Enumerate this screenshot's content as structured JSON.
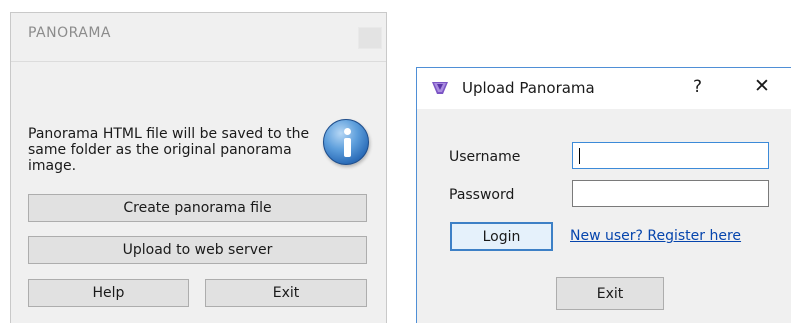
{
  "panorama_window": {
    "title": "PANORAMA",
    "message_lines": [
      "Panorama HTML file will be saved to the",
      "same folder as the original panorama",
      "image."
    ],
    "buttons": {
      "create": "Create panorama file",
      "upload": "Upload to web server",
      "help": "Help",
      "exit": "Exit"
    }
  },
  "upload_dialog": {
    "title": "Upload Panorama",
    "help_glyph": "?",
    "close_glyph": "✕",
    "username_label": "Username",
    "username_value": "",
    "password_label": "Password",
    "password_value": "",
    "login_button": "Login",
    "register_link": "New user? Register here",
    "exit_button": "Exit"
  },
  "colors": {
    "window_bg": "#f0f0f0",
    "accent_border": "#3d80c6",
    "link": "#0645ad"
  },
  "icons": {
    "info": "info-icon",
    "app": "panorama-app-icon"
  }
}
